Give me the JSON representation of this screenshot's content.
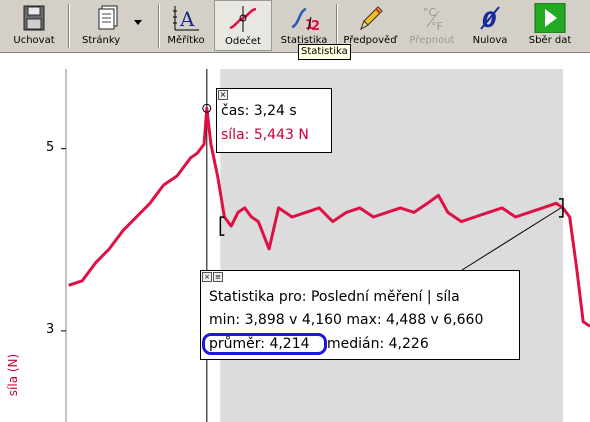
{
  "toolbar": {
    "buttons": [
      {
        "label": "Uchovat",
        "icon": "save-disk-icon"
      },
      {
        "label": "Stránky",
        "icon": "pages-icon"
      },
      {
        "label": "Měřítko",
        "icon": "autoscale-icon"
      },
      {
        "label": "Odečet",
        "icon": "examine-icon"
      },
      {
        "label": "Statistika",
        "icon": "statistics-icon"
      },
      {
        "label": "Předpověď",
        "icon": "pencil-prediction-icon"
      },
      {
        "label": "Přepnout",
        "icon": "switch-units-icon"
      },
      {
        "label": "Nulova",
        "icon": "zero-icon"
      },
      {
        "label": "Sběr dat",
        "icon": "play-collect-icon"
      }
    ],
    "tooltip": "Statistika",
    "accent_play": "#22aa22"
  },
  "graph": {
    "y_axis_label": "síla (N)",
    "y_ticks": [
      "5",
      "3"
    ],
    "line_color": "#dd1144"
  },
  "readout": {
    "time_text": "čas: 3,24 s",
    "force_text": "síla: 5,443 N"
  },
  "stats": {
    "line1": "Statistika pro: Poslední měření | síla",
    "line2": "min: 3,898 v 4,160 max: 4,488 v 6,660",
    "mean": "průměr: 4,214",
    "median": "medián: 4,226",
    "highlight_color": "#1a1ad8"
  },
  "chart_data": {
    "type": "line",
    "xlabel": "",
    "ylabel": "síla (N)",
    "x": [
      1.2,
      1.4,
      1.6,
      1.8,
      2.0,
      2.2,
      2.4,
      2.6,
      2.8,
      3.0,
      3.1,
      3.2,
      3.24,
      3.3,
      3.4,
      3.5,
      3.6,
      3.7,
      3.8,
      3.9,
      4.0,
      4.16,
      4.3,
      4.5,
      4.7,
      4.9,
      5.1,
      5.3,
      5.5,
      5.7,
      5.9,
      6.1,
      6.3,
      6.5,
      6.66,
      6.8,
      7.0,
      7.2,
      7.4,
      7.6,
      7.8,
      8.0,
      8.2,
      8.4,
      8.5,
      8.6,
      8.7,
      8.8,
      8.9
    ],
    "y": [
      3.5,
      3.55,
      3.75,
      3.9,
      4.1,
      4.25,
      4.4,
      4.6,
      4.7,
      4.9,
      4.95,
      5.05,
      5.443,
      5.05,
      4.7,
      4.25,
      4.15,
      4.3,
      4.35,
      4.25,
      4.2,
      3.9,
      4.35,
      4.25,
      4.3,
      4.35,
      4.2,
      4.3,
      4.35,
      4.25,
      4.3,
      4.35,
      4.3,
      4.4,
      4.488,
      4.3,
      4.2,
      4.25,
      4.3,
      4.35,
      4.25,
      4.3,
      4.35,
      4.4,
      4.35,
      4.25,
      3.7,
      3.1,
      3.05
    ],
    "xlim": [
      1.16,
      8.9
    ],
    "ylim": [
      2.0,
      6.05
    ],
    "selection": [
      3.44,
      8.5
    ],
    "cursor_x": 3.24,
    "grid": false
  }
}
